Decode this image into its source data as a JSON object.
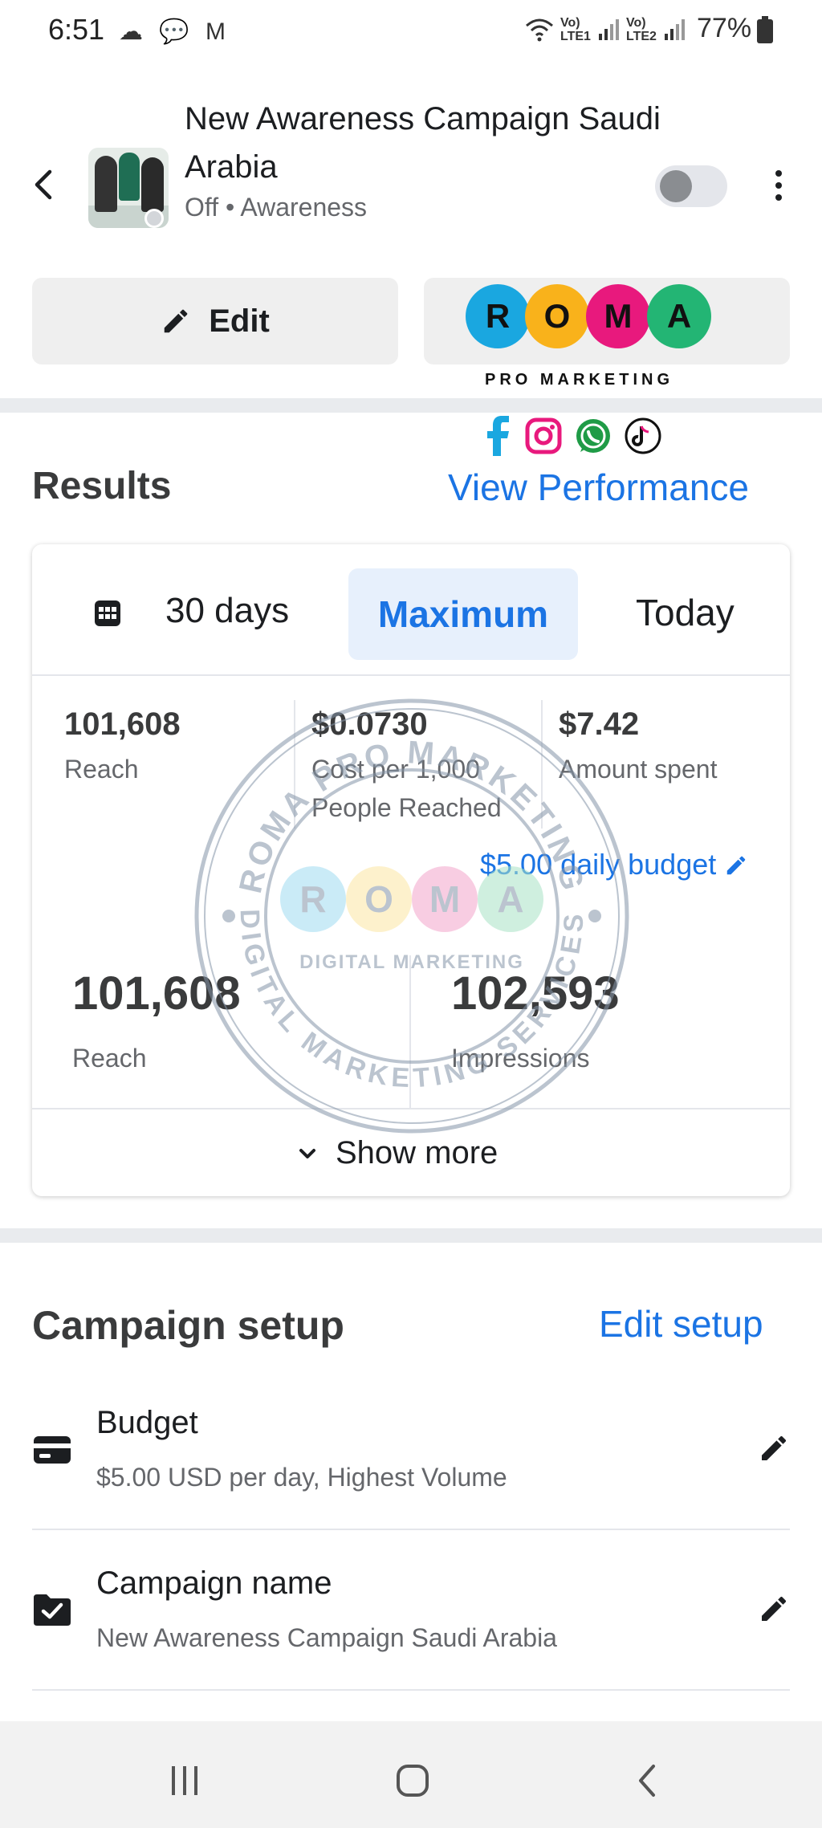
{
  "status_bar": {
    "time": "6:51",
    "left_icons": "☁ 💬 M",
    "network_1": "Vo) LTE1",
    "network_2": "Vo) LTE2",
    "battery": "77%"
  },
  "header": {
    "title": "New Awareness Campaign Saudi Arabia",
    "status": "Off",
    "objective": "Awareness",
    "toggle_state": "off"
  },
  "actions": {
    "edit_label": "Edit",
    "logo_letters": [
      "R",
      "O",
      "M",
      "A"
    ],
    "logo_colors": [
      "#1aa7e0",
      "#f9b21b",
      "#e8197d",
      "#23b574"
    ],
    "logo_tagline": "PRO MARKETING"
  },
  "social_icons": [
    "facebook-icon",
    "instagram-icon",
    "whatsapp-icon",
    "tiktok-icon"
  ],
  "results": {
    "title": "Results",
    "view_performance": "View Performance",
    "segments": {
      "days": "30 days",
      "maximum": "Maximum",
      "today": "Today",
      "selected": "Maximum"
    },
    "metrics": [
      {
        "value": "101,608",
        "label": "Reach"
      },
      {
        "value": "$0.0730",
        "label": "Cost per 1,000 People Reached"
      },
      {
        "value": "$7.42",
        "label": "Amount spent"
      }
    ],
    "budget_link": "$5.00 daily budget",
    "big_metrics": [
      {
        "value": "101,608",
        "label": "Reach"
      },
      {
        "value": "102,593",
        "label": "Impressions"
      }
    ],
    "show_more": "Show more"
  },
  "watermark": {
    "top_text": "ROMA PRO MARKETING",
    "bottom_text": "DIGITAL MARKETING SERVICES",
    "center_letters": [
      "R",
      "O",
      "M",
      "A"
    ],
    "center_tagline": "DIGITAL MARKETING"
  },
  "campaign_setup": {
    "title": "Campaign setup",
    "edit_setup": "Edit setup",
    "rows": [
      {
        "title": "Budget",
        "subtitle": "$5.00 USD per day, Highest Volume"
      },
      {
        "title": "Campaign name",
        "subtitle": "New Awareness Campaign Saudi Arabia"
      }
    ]
  },
  "colors": {
    "accent": "#1b74e4",
    "selected_bg": "#e7f0fc",
    "band": "#e9ebee"
  }
}
